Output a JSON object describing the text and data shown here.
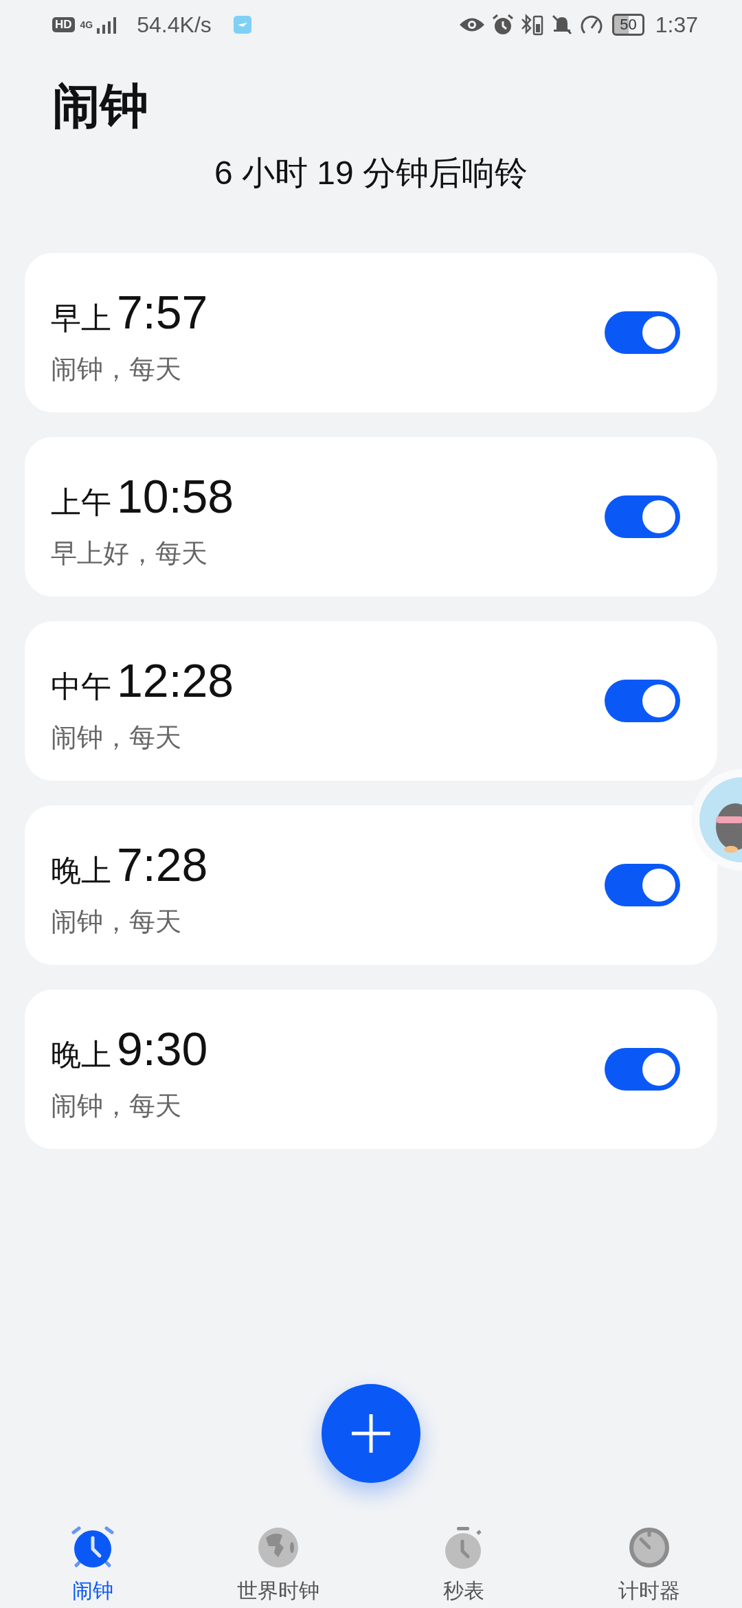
{
  "status_bar": {
    "hd": "HD",
    "network": "4G",
    "speed": "54.4K/s",
    "battery": "50",
    "time": "1:37"
  },
  "title": "闹钟",
  "next_ring": "6 小时 19 分钟后响铃",
  "alarms": [
    {
      "period": "早上",
      "time": "7:57",
      "label": "闹钟，每天",
      "on": true
    },
    {
      "period": "上午",
      "time": "10:58",
      "label": "早上好，每天",
      "on": true
    },
    {
      "period": "中午",
      "time": "12:28",
      "label": "闹钟，每天",
      "on": true
    },
    {
      "period": "晚上",
      "time": "7:28",
      "label": "闹钟，每天",
      "on": true
    },
    {
      "period": "晚上",
      "time": "9:30",
      "label": "闹钟，每天",
      "on": true
    }
  ],
  "tabs": [
    {
      "kind": "alarm",
      "label": "闹钟",
      "selected": true
    },
    {
      "kind": "world",
      "label": "世界时钟",
      "selected": false
    },
    {
      "kind": "stopwatch",
      "label": "秒表",
      "selected": false
    },
    {
      "kind": "timer",
      "label": "计时器",
      "selected": false
    }
  ]
}
